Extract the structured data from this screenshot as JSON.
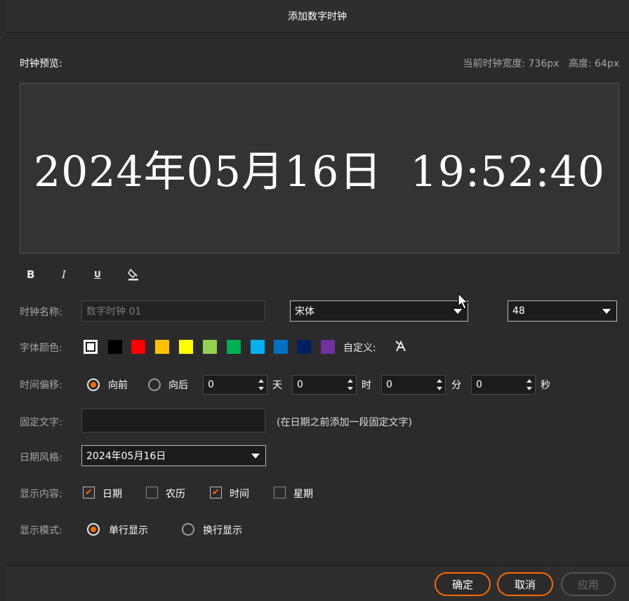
{
  "dialog": {
    "title": "添加数字时钟"
  },
  "preview": {
    "label": "时钟预览:",
    "size_info": "当前时钟宽度: 736px   高度: 64px",
    "clock_text": "2024年05月16日  19:52:40"
  },
  "format_toolbar": {
    "bold": "B",
    "italic": "I",
    "underline": "U",
    "fill": "fill-color-icon"
  },
  "name": {
    "label": "时钟名称:",
    "placeholder": "数字时钟 01"
  },
  "font": {
    "family": "宋体",
    "size": "48"
  },
  "color": {
    "label": "字体颜色:",
    "swatches": [
      "#ffffff",
      "#000000",
      "#ff0000",
      "#ffc000",
      "#ffff00",
      "#92d050",
      "#00b050",
      "#00b0f0",
      "#0070c0",
      "#002060",
      "#7030a0"
    ],
    "custom_label": "自定义:",
    "custom_icon": "eyedropper-icon"
  },
  "offset": {
    "label": "时间偏移:",
    "forward": "向前",
    "backward": "向后",
    "days": "0",
    "days_unit": "天",
    "hours": "0",
    "hours_unit": "时",
    "minutes": "0",
    "minutes_unit": "分",
    "seconds": "0",
    "seconds_unit": "秒"
  },
  "fixed_text": {
    "label": "固定文字:",
    "hint": "(在日期之前添加一段固定文字)"
  },
  "date_style": {
    "label": "日期风格:",
    "value": "2024年05月16日"
  },
  "display_content": {
    "label": "显示内容:",
    "date": "日期",
    "lunar": "农历",
    "time": "时间",
    "weekday": "星期"
  },
  "display_mode": {
    "label": "显示模式:",
    "single": "单行显示",
    "wrap": "换行显示"
  },
  "buttons": {
    "ok": "确定",
    "cancel": "取消",
    "apply": "应用"
  }
}
